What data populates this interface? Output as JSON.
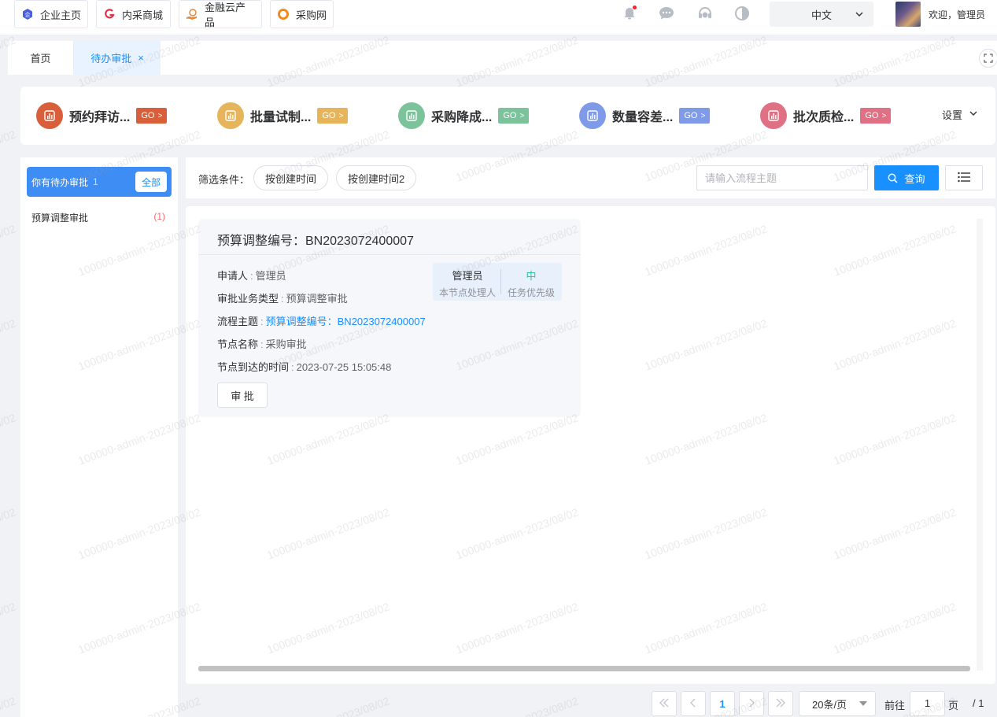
{
  "topbar": {
    "links": [
      {
        "label": "企业主页",
        "icon": "enterprise-icon"
      },
      {
        "label": "内采商城",
        "icon": "mall-icon"
      },
      {
        "label": "金融云产品",
        "icon": "finance-icon"
      },
      {
        "label": "采购网",
        "icon": "purchase-icon"
      }
    ],
    "language": "中文",
    "welcome": "欢迎，管理员"
  },
  "tabs": [
    {
      "label": "首页"
    },
    {
      "label": "待办审批",
      "close": "×"
    }
  ],
  "quick": {
    "items": [
      {
        "title": "预约拜访...",
        "go": "GO",
        "color": "#d95f3b",
        "go_color": "#d95f3b"
      },
      {
        "title": "批量试制...",
        "go": "GO",
        "color": "#e6b45a",
        "go_color": "#e6b45a"
      },
      {
        "title": "采购降成...",
        "go": "GO",
        "color": "#7cc39b",
        "go_color": "#7cc39b"
      },
      {
        "title": "数量容差...",
        "go": "GO",
        "color": "#7e9ae8",
        "go_color": "#7e9ae8"
      },
      {
        "title": "批次质检...",
        "go": "GO",
        "color": "#e07083",
        "go_color": "#e07083"
      }
    ],
    "setting": "设置"
  },
  "left": {
    "head": "你有待办审批",
    "head_count": "1",
    "all_button": "全部",
    "items": [
      {
        "label": "预算调整审批",
        "count": "(1)"
      }
    ]
  },
  "filter": {
    "label": "筛选条件：",
    "chips": [
      "按创建时间",
      "按创建时间2"
    ],
    "search_placeholder": "请输入流程主题",
    "query": "查询"
  },
  "card": {
    "title": "预算调整编号：BN2023072400007",
    "fields": [
      {
        "label": "申请人",
        "value": "管理员",
        "link": false
      },
      {
        "label": "审批业务类型",
        "value": "预算调整审批",
        "link": false
      },
      {
        "label": "流程主题",
        "value": "预算调整编号：BN2023072400007",
        "link": true
      },
      {
        "label": "节点名称",
        "value": "采购审批",
        "link": false
      },
      {
        "label": "节点到达的时间",
        "value": "2023-07-25 15:05:48",
        "link": false
      }
    ],
    "colon": ":",
    "handler": "管理员",
    "handler_label": "本节点处理人",
    "priority": "中",
    "priority_label": "任务优先级",
    "approve": "审 批"
  },
  "pagination": {
    "current": "1",
    "page_size": "20条/页",
    "goto": "前往",
    "goto_value": "1",
    "page_unit": "页",
    "total": "/ 1"
  },
  "watermark": "100000-admin-2023/08/02"
}
